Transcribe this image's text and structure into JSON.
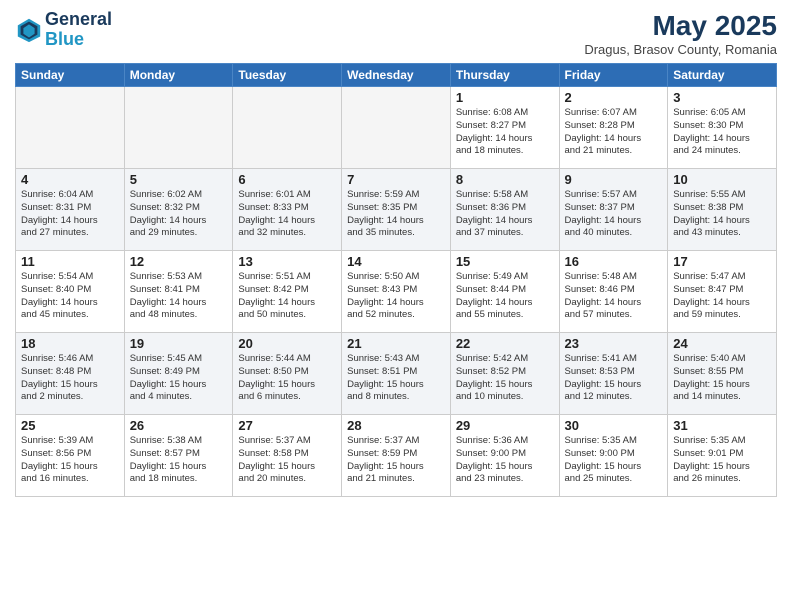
{
  "header": {
    "logo_line1": "General",
    "logo_line2": "Blue",
    "title": "May 2025",
    "subtitle": "Dragus, Brasov County, Romania"
  },
  "weekdays": [
    "Sunday",
    "Monday",
    "Tuesday",
    "Wednesday",
    "Thursday",
    "Friday",
    "Saturday"
  ],
  "weeks": [
    [
      {
        "day": "",
        "info": ""
      },
      {
        "day": "",
        "info": ""
      },
      {
        "day": "",
        "info": ""
      },
      {
        "day": "",
        "info": ""
      },
      {
        "day": "1",
        "info": "Sunrise: 6:08 AM\nSunset: 8:27 PM\nDaylight: 14 hours\nand 18 minutes."
      },
      {
        "day": "2",
        "info": "Sunrise: 6:07 AM\nSunset: 8:28 PM\nDaylight: 14 hours\nand 21 minutes."
      },
      {
        "day": "3",
        "info": "Sunrise: 6:05 AM\nSunset: 8:30 PM\nDaylight: 14 hours\nand 24 minutes."
      }
    ],
    [
      {
        "day": "4",
        "info": "Sunrise: 6:04 AM\nSunset: 8:31 PM\nDaylight: 14 hours\nand 27 minutes."
      },
      {
        "day": "5",
        "info": "Sunrise: 6:02 AM\nSunset: 8:32 PM\nDaylight: 14 hours\nand 29 minutes."
      },
      {
        "day": "6",
        "info": "Sunrise: 6:01 AM\nSunset: 8:33 PM\nDaylight: 14 hours\nand 32 minutes."
      },
      {
        "day": "7",
        "info": "Sunrise: 5:59 AM\nSunset: 8:35 PM\nDaylight: 14 hours\nand 35 minutes."
      },
      {
        "day": "8",
        "info": "Sunrise: 5:58 AM\nSunset: 8:36 PM\nDaylight: 14 hours\nand 37 minutes."
      },
      {
        "day": "9",
        "info": "Sunrise: 5:57 AM\nSunset: 8:37 PM\nDaylight: 14 hours\nand 40 minutes."
      },
      {
        "day": "10",
        "info": "Sunrise: 5:55 AM\nSunset: 8:38 PM\nDaylight: 14 hours\nand 43 minutes."
      }
    ],
    [
      {
        "day": "11",
        "info": "Sunrise: 5:54 AM\nSunset: 8:40 PM\nDaylight: 14 hours\nand 45 minutes."
      },
      {
        "day": "12",
        "info": "Sunrise: 5:53 AM\nSunset: 8:41 PM\nDaylight: 14 hours\nand 48 minutes."
      },
      {
        "day": "13",
        "info": "Sunrise: 5:51 AM\nSunset: 8:42 PM\nDaylight: 14 hours\nand 50 minutes."
      },
      {
        "day": "14",
        "info": "Sunrise: 5:50 AM\nSunset: 8:43 PM\nDaylight: 14 hours\nand 52 minutes."
      },
      {
        "day": "15",
        "info": "Sunrise: 5:49 AM\nSunset: 8:44 PM\nDaylight: 14 hours\nand 55 minutes."
      },
      {
        "day": "16",
        "info": "Sunrise: 5:48 AM\nSunset: 8:46 PM\nDaylight: 14 hours\nand 57 minutes."
      },
      {
        "day": "17",
        "info": "Sunrise: 5:47 AM\nSunset: 8:47 PM\nDaylight: 14 hours\nand 59 minutes."
      }
    ],
    [
      {
        "day": "18",
        "info": "Sunrise: 5:46 AM\nSunset: 8:48 PM\nDaylight: 15 hours\nand 2 minutes."
      },
      {
        "day": "19",
        "info": "Sunrise: 5:45 AM\nSunset: 8:49 PM\nDaylight: 15 hours\nand 4 minutes."
      },
      {
        "day": "20",
        "info": "Sunrise: 5:44 AM\nSunset: 8:50 PM\nDaylight: 15 hours\nand 6 minutes."
      },
      {
        "day": "21",
        "info": "Sunrise: 5:43 AM\nSunset: 8:51 PM\nDaylight: 15 hours\nand 8 minutes."
      },
      {
        "day": "22",
        "info": "Sunrise: 5:42 AM\nSunset: 8:52 PM\nDaylight: 15 hours\nand 10 minutes."
      },
      {
        "day": "23",
        "info": "Sunrise: 5:41 AM\nSunset: 8:53 PM\nDaylight: 15 hours\nand 12 minutes."
      },
      {
        "day": "24",
        "info": "Sunrise: 5:40 AM\nSunset: 8:55 PM\nDaylight: 15 hours\nand 14 minutes."
      }
    ],
    [
      {
        "day": "25",
        "info": "Sunrise: 5:39 AM\nSunset: 8:56 PM\nDaylight: 15 hours\nand 16 minutes."
      },
      {
        "day": "26",
        "info": "Sunrise: 5:38 AM\nSunset: 8:57 PM\nDaylight: 15 hours\nand 18 minutes."
      },
      {
        "day": "27",
        "info": "Sunrise: 5:37 AM\nSunset: 8:58 PM\nDaylight: 15 hours\nand 20 minutes."
      },
      {
        "day": "28",
        "info": "Sunrise: 5:37 AM\nSunset: 8:59 PM\nDaylight: 15 hours\nand 21 minutes."
      },
      {
        "day": "29",
        "info": "Sunrise: 5:36 AM\nSunset: 9:00 PM\nDaylight: 15 hours\nand 23 minutes."
      },
      {
        "day": "30",
        "info": "Sunrise: 5:35 AM\nSunset: 9:00 PM\nDaylight: 15 hours\nand 25 minutes."
      },
      {
        "day": "31",
        "info": "Sunrise: 5:35 AM\nSunset: 9:01 PM\nDaylight: 15 hours\nand 26 minutes."
      }
    ]
  ]
}
